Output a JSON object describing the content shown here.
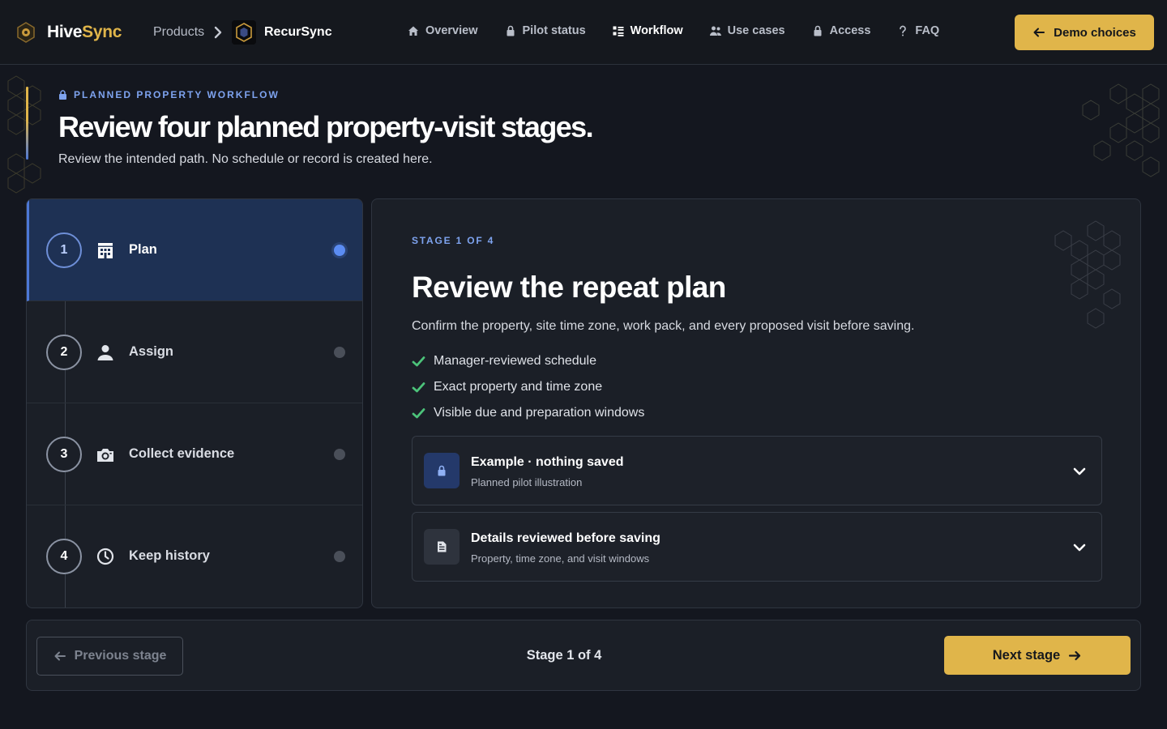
{
  "header": {
    "brand_part1": "Hive",
    "brand_part2": "Sync",
    "products_label": "Products",
    "product_name": "RecurSync",
    "nav": [
      {
        "label": "Overview",
        "icon": "home-icon",
        "active": false
      },
      {
        "label": "Pilot status",
        "icon": "lock-icon",
        "active": false
      },
      {
        "label": "Workflow",
        "icon": "list-icon",
        "active": true
      },
      {
        "label": "Use cases",
        "icon": "users-icon",
        "active": false
      },
      {
        "label": "Access",
        "icon": "lock-icon",
        "active": false
      },
      {
        "label": "FAQ",
        "icon": "question-icon",
        "active": false
      }
    ],
    "demo_button": "Demo choices"
  },
  "intro": {
    "eyebrow": "PLANNED PROPERTY WORKFLOW",
    "title": "Review four planned property-visit stages.",
    "subtitle": "Review the intended path. No schedule or record is created here."
  },
  "stages": [
    {
      "number": "1",
      "label": "Plan",
      "icon": "building-icon",
      "active": true
    },
    {
      "number": "2",
      "label": "Assign",
      "icon": "user-icon",
      "active": false
    },
    {
      "number": "3",
      "label": "Collect evidence",
      "icon": "camera-icon",
      "active": false
    },
    {
      "number": "4",
      "label": "Keep history",
      "icon": "clock-icon",
      "active": false
    }
  ],
  "detail": {
    "eyebrow": "STAGE 1 OF 4",
    "title": "Review the repeat plan",
    "description": "Confirm the property, site time zone, work pack, and every proposed visit before saving.",
    "checks": [
      "Manager-reviewed schedule",
      "Exact property and time zone",
      "Visible due and preparation windows"
    ],
    "accordions": [
      {
        "title": "Example · nothing saved",
        "subtitle": "Planned pilot illustration",
        "icon": "lock-icon"
      },
      {
        "title": "Details reviewed before saving",
        "subtitle": "Property, time zone, and visit windows",
        "icon": "document-icon"
      }
    ]
  },
  "pager": {
    "prev_label": "Previous stage",
    "status": "Stage 1 of 4",
    "next_label": "Next stage"
  },
  "colors": {
    "accent_gold": "#e0b54a",
    "accent_blue": "#7ea3ef",
    "active_stage_bg": "#1e3154",
    "check_green": "#4cc37a",
    "page_bg": "#14171f"
  }
}
